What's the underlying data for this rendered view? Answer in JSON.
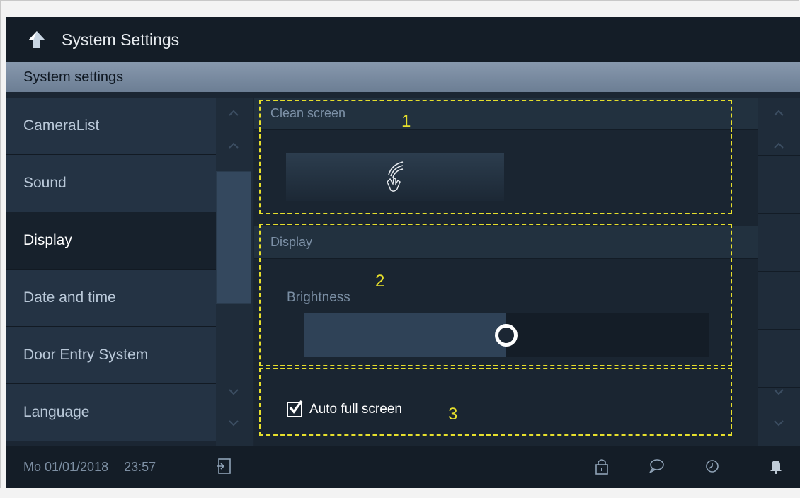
{
  "titlebar": {
    "title": "System Settings",
    "back_icon": "back-arrow-icon"
  },
  "section_header": "System settings",
  "sidebar": {
    "items": [
      {
        "label": "CameraList",
        "active": false
      },
      {
        "label": "Sound",
        "active": false
      },
      {
        "label": "Display",
        "active": true
      },
      {
        "label": "Date and time",
        "active": false
      },
      {
        "label": "Door Entry System",
        "active": false
      },
      {
        "label": "Language",
        "active": false
      }
    ]
  },
  "content": {
    "clean_screen": {
      "header": "Clean screen",
      "button_icon": "hand-wave-icon"
    },
    "display": {
      "header": "Display",
      "brightness_label": "Brightness",
      "brightness_level": 0.5
    },
    "auto_full_screen": {
      "label": "Auto full screen",
      "checked": true
    }
  },
  "annotations": [
    "1",
    "2",
    "3"
  ],
  "statusbar": {
    "date": "Mo 01/01/2018",
    "time": "23:57",
    "icons": [
      "logout-icon",
      "lock-icon",
      "message-icon",
      "history-icon",
      "bell-icon"
    ]
  },
  "colors": {
    "annotation": "#e6df2c",
    "background": "#1b2633",
    "header_band": "#7a8ca2"
  }
}
